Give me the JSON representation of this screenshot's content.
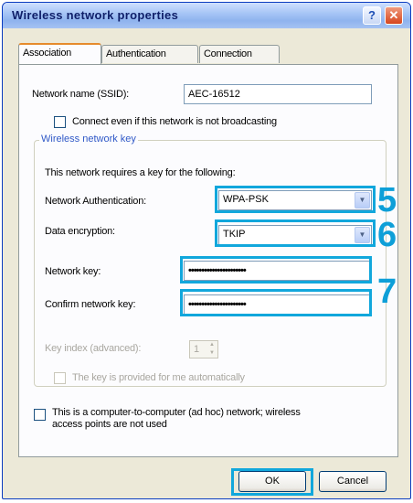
{
  "window": {
    "title": "Wireless network properties",
    "help_symbol": "?",
    "close_symbol": "✕"
  },
  "tabs": [
    {
      "label": "Association"
    },
    {
      "label": "Authentication"
    },
    {
      "label": "Connection"
    }
  ],
  "association": {
    "ssid_label": "Network name (SSID):",
    "ssid_value": "AEC-16512",
    "broadcast_checkbox_label": "Connect even if this network is not broadcasting",
    "group_title": "Wireless network key",
    "requires_key_text": "This network requires a key for the following:",
    "auth_label": "Network Authentication:",
    "auth_value": "WPA-PSK",
    "encryption_label": "Data encryption:",
    "encryption_value": "TKIP",
    "network_key_label": "Network key:",
    "network_key_value": "••••••••••••••••••••••",
    "confirm_key_label": "Confirm network key:",
    "confirm_key_value": "••••••••••••••••••••••",
    "key_index_label": "Key index (advanced):",
    "key_index_value": "1",
    "auto_key_label": "The key is provided for me automatically",
    "adhoc_label_line1": "This is a computer-to-computer (ad hoc) network; wireless",
    "adhoc_label_line2": "access points are not used"
  },
  "annotations": {
    "step_auth": "5",
    "step_encryption": "6",
    "step_keys": "7",
    "highlight_color": "#11a7dc"
  },
  "buttons": {
    "ok": "OK",
    "cancel": "Cancel"
  }
}
